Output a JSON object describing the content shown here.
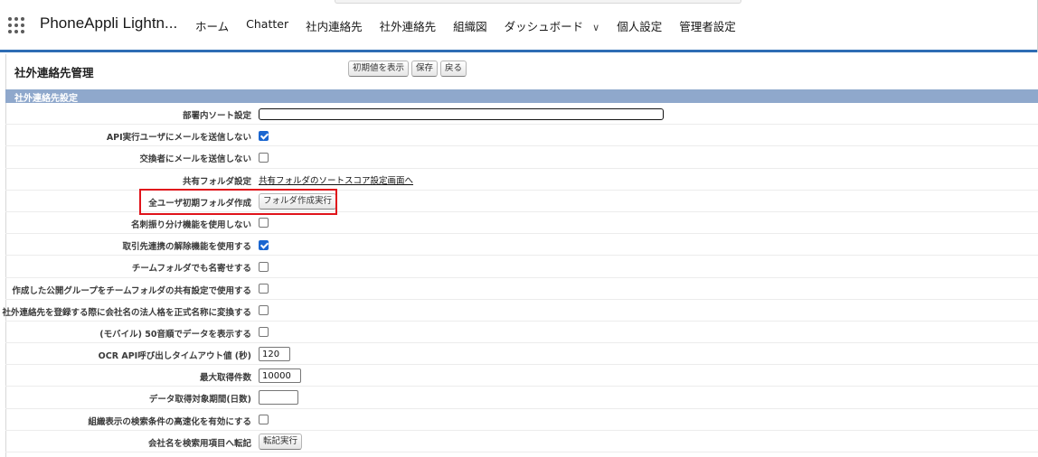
{
  "app": {
    "name": "PhoneAppli Lightn...",
    "nav": [
      {
        "label": "ホーム"
      },
      {
        "label": "Chatter"
      },
      {
        "label": "社内連絡先"
      },
      {
        "label": "社外連絡先"
      },
      {
        "label": "組織図"
      },
      {
        "label": "ダッシュボード",
        "dropdown": true
      },
      {
        "label": "個人設定"
      },
      {
        "label": "管理者設定"
      }
    ]
  },
  "page": {
    "title": "社外連絡先管理",
    "buttons": {
      "show_defaults": "初期値を表示",
      "save": "保存",
      "back": "戻る"
    },
    "section_title": "社外連絡先設定"
  },
  "settings": {
    "sort_in_dept": {
      "label": "部署内ソート設定",
      "value": ""
    },
    "api_user_no_mail": {
      "label": "API実行ユーザにメールを送信しない",
      "checked": true
    },
    "exchanger_no_mail": {
      "label": "交換者にメールを送信しない",
      "checked": false
    },
    "shared_folder": {
      "label": "共有フォルダ設定",
      "link": "共有フォルダのソートスコア設定画面へ"
    },
    "all_user_folder": {
      "label": "全ユーザ初期フォルダ作成",
      "button": "フォルダ作成実行"
    },
    "no_card_sort": {
      "label": "名刺振り分け機能を使用しない",
      "checked": false
    },
    "account_unlink": {
      "label": "取引先連携の解除機能を使用する",
      "checked": true
    },
    "team_folder_gather": {
      "label": "チームフォルダでも名寄せする",
      "checked": false
    },
    "public_group_share": {
      "label": "作成した公開グループをチームフォルダの共有設定で使用する",
      "checked": false
    },
    "company_legal_name": {
      "label": "社外連絡先を登録する際に会社名の法人格を正式名称に変換する",
      "checked": false
    },
    "mobile_50on": {
      "label": "(モバイル) 50音順でデータを表示する",
      "checked": false
    },
    "ocr_timeout": {
      "label": "OCR API呼び出しタイムアウト値 (秒)",
      "value": "120"
    },
    "max_fetch": {
      "label": "最大取得件数",
      "value": "10000"
    },
    "fetch_period": {
      "label": "データ取得対象期間(日数)",
      "value": ""
    },
    "org_search_fast": {
      "label": "組織表示の検索条件の高速化を有効にする",
      "checked": false
    },
    "company_transfer": {
      "label": "会社名を検索用項目へ転記",
      "button": "転記実行"
    }
  },
  "colors": {
    "section_bar": "#8fa8cc",
    "checkbox_on": "#1a66d0",
    "highlight": "#e0141b",
    "top_border": "#2e6db4"
  }
}
